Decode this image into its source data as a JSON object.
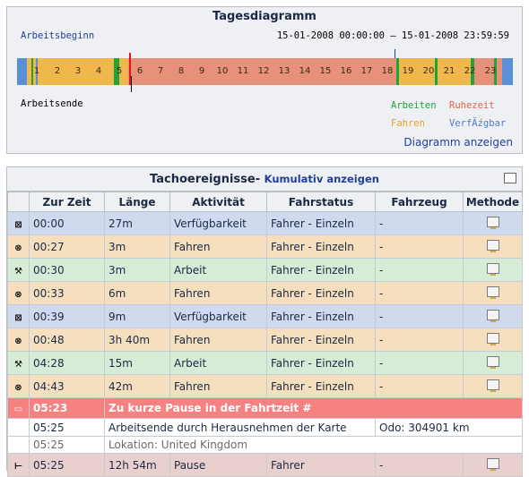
{
  "diagram": {
    "title": "Tagesdiagramm",
    "work_start_label": "Arbeitsbeginn",
    "range": "15-01-2008 00:00:00 – 15-01-2008 23:59:59",
    "work_end_label": "Arbeitsende",
    "hours": [
      "1",
      "2",
      "3",
      "4",
      "5",
      "6",
      "7",
      "8",
      "9",
      "10",
      "11",
      "12",
      "13",
      "14",
      "15",
      "16",
      "17",
      "18",
      "19",
      "20",
      "21",
      "22",
      "23"
    ],
    "legend": {
      "arbeiten": "Arbeiten",
      "ruhezeit": "Ruhezeit",
      "fahren": "Fahren",
      "verfuegbar": "VerfĂźgbar"
    },
    "show_diagram": "Diagramm anzeigen",
    "colors": {
      "drive": "#f0b84c",
      "rest": "#e8917a",
      "work": "#1fa43a",
      "avail": "#5b8fd8"
    }
  },
  "events": {
    "title": "Tachoereignisse-",
    "cumulative_link": "Kumulativ anzeigen",
    "columns": [
      "Zur Zeit",
      "Länge",
      "Aktivität",
      "Fahrstatus",
      "Fahrzeug",
      "Methode"
    ],
    "rows": [
      {
        "icon": "verfuegbar",
        "time": "00:00",
        "length": "27m",
        "activity": "Verfügbarkeit",
        "status": "Fahrer - Einzeln",
        "vehicle": "-",
        "cls": "b"
      },
      {
        "icon": "fahren",
        "time": "00:27",
        "length": "3m",
        "activity": "Fahren",
        "status": "Fahrer - Einzeln",
        "vehicle": "-",
        "cls": "o"
      },
      {
        "icon": "arbeit",
        "time": "00:30",
        "length": "3m",
        "activity": "Arbeit",
        "status": "Fahrer - Einzeln",
        "vehicle": "-",
        "cls": "g"
      },
      {
        "icon": "fahren",
        "time": "00:33",
        "length": "6m",
        "activity": "Fahren",
        "status": "Fahrer - Einzeln",
        "vehicle": "-",
        "cls": "o"
      },
      {
        "icon": "verfuegbar",
        "time": "00:39",
        "length": "9m",
        "activity": "Verfügbarkeit",
        "status": "Fahrer - Einzeln",
        "vehicle": "-",
        "cls": "b"
      },
      {
        "icon": "fahren",
        "time": "00:48",
        "length": "3h 40m",
        "activity": "Fahren",
        "status": "Fahrer - Einzeln",
        "vehicle": "-",
        "cls": "o"
      },
      {
        "icon": "arbeit",
        "time": "04:28",
        "length": "15m",
        "activity": "Arbeit",
        "status": "Fahrer - Einzeln",
        "vehicle": "-",
        "cls": "g"
      },
      {
        "icon": "fahren",
        "time": "04:43",
        "length": "42m",
        "activity": "Fahren",
        "status": "Fahrer - Einzeln",
        "vehicle": "-",
        "cls": "o"
      }
    ],
    "alert": {
      "time": "05:23",
      "text": "Zu kurze Pause in der Fahrtzeit #"
    },
    "card_event": {
      "time": "05:25",
      "text": "Arbeitsende durch Herausnehmen der Karte",
      "odo": "Odo: 304901 km"
    },
    "location": {
      "time": "05:25",
      "text": "Lokation: United Kingdom"
    },
    "last_row": {
      "icon": "pause",
      "time": "05:25",
      "length": "12h 54m",
      "activity": "Pause",
      "status": "Fahrer",
      "vehicle": "-",
      "cls": "p"
    }
  }
}
